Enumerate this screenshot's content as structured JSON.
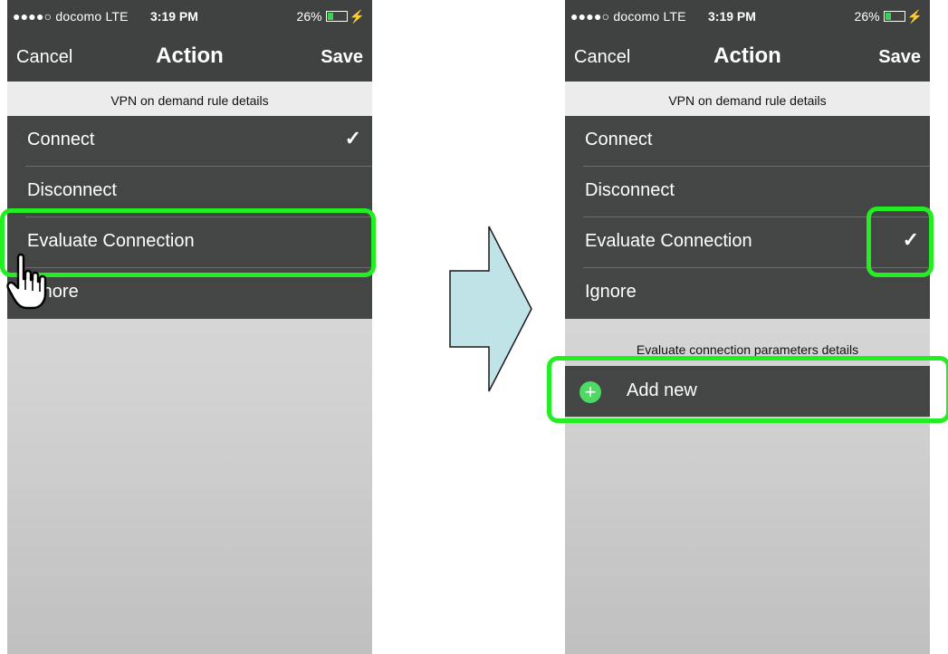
{
  "left": {
    "status": {
      "carrier": "●●●●○ docomo  LTE",
      "time": "3:19 PM",
      "battery": "26%"
    },
    "nav": {
      "cancel": "Cancel",
      "title": "Action",
      "save": "Save"
    },
    "section_header": "VPN on demand rule details",
    "rows": [
      {
        "label": "Connect",
        "check": "✓"
      },
      {
        "label": "Disconnect",
        "check": ""
      },
      {
        "label": "Evaluate Connection",
        "check": ""
      },
      {
        "label": "Ignore",
        "check": ""
      }
    ]
  },
  "right": {
    "status": {
      "carrier": "●●●●○ docomo  LTE",
      "time": "3:19 PM",
      "battery": "26%"
    },
    "nav": {
      "cancel": "Cancel",
      "title": "Action",
      "save": "Save"
    },
    "section_header": "VPN on demand rule details",
    "rows": [
      {
        "label": "Connect",
        "check": ""
      },
      {
        "label": "Disconnect",
        "check": ""
      },
      {
        "label": "Evaluate Connection",
        "check": "✓"
      },
      {
        "label": "Ignore",
        "check": ""
      }
    ],
    "params_header": "Evaluate connection parameters details",
    "add_new": {
      "icon": "plus-circle-icon",
      "label": "Add new"
    }
  },
  "annotations": {
    "highlight_color": "#22ee22",
    "arrow_fill": "#bfe3e6",
    "cursor": "hand-pointer-icon"
  }
}
